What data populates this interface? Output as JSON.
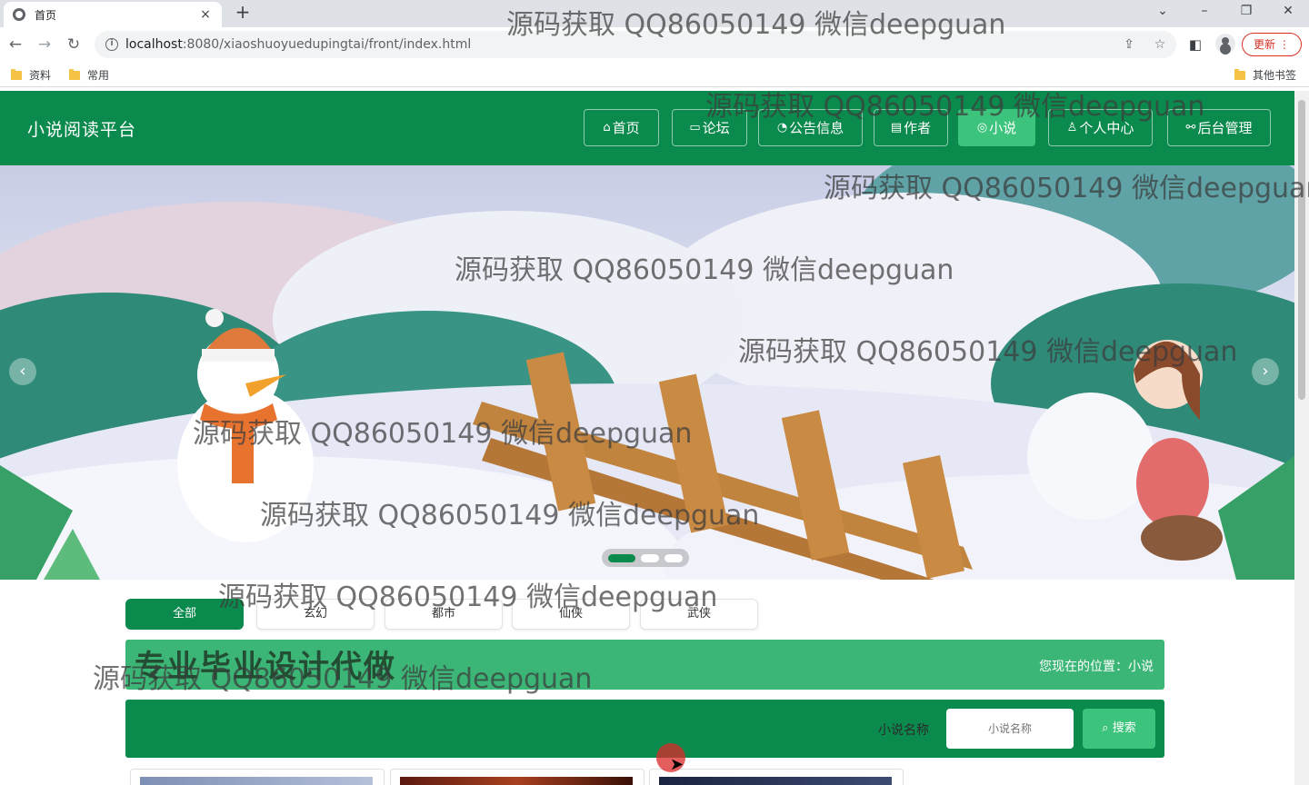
{
  "browser": {
    "tab_title": "首页",
    "tab_close": "×",
    "new_tab": "+",
    "url_host": "localhost",
    "url_rest": ":8080/xiaoshuoyuedupingtai/front/index.html",
    "update_label": "更新",
    "bookmarks": [
      "资料",
      "常用"
    ],
    "other_bookmarks": "其他书签"
  },
  "site": {
    "title": "小说阅读平台",
    "nav": [
      {
        "icon": "⌂",
        "label": "首页"
      },
      {
        "icon": "▭",
        "label": "论坛"
      },
      {
        "icon": "◔",
        "label": "公告信息"
      },
      {
        "icon": "▤",
        "label": "作者"
      },
      {
        "icon": "◎",
        "label": "小说"
      },
      {
        "icon": "♙",
        "label": "个人中心"
      },
      {
        "icon": "⚯",
        "label": "后台管理"
      }
    ],
    "active_nav": "小说"
  },
  "banner": {
    "slides": 3,
    "active_slide": 1,
    "prev": "‹",
    "next": "›"
  },
  "categories": [
    "全部",
    "玄幻",
    "都市",
    "仙侠",
    "武侠"
  ],
  "active_category": "全部",
  "breadcrumb": "您现在的位置：小说",
  "overlay_text": "专业毕业设计代做",
  "search": {
    "label": "小说名称",
    "placeholder": "小说名称",
    "button": "搜索"
  },
  "watermark": "源码获取 QQ86050149 微信deepguan",
  "colors": {
    "header_green": "#0b8a4d",
    "accent_green": "#3cc47c",
    "breadcrumb_green": "#3cb676"
  }
}
